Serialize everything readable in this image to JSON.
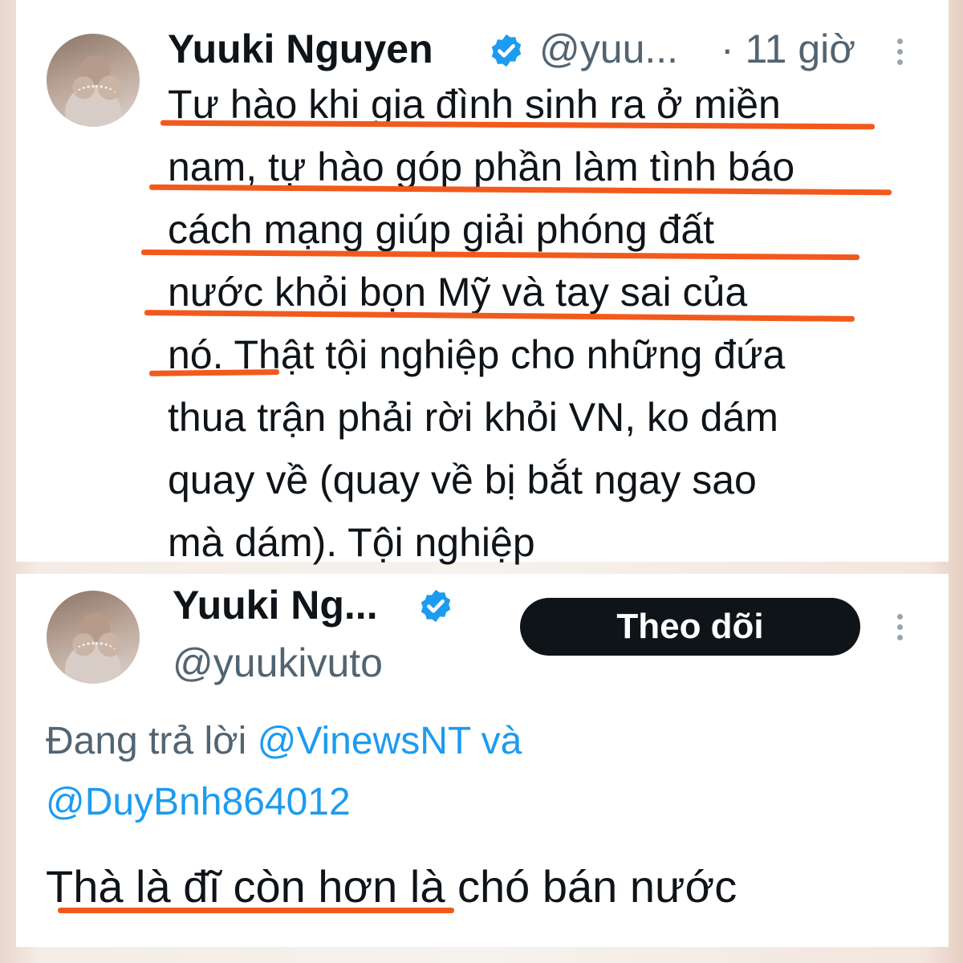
{
  "tweet1": {
    "name": "Yuuki Nguyen",
    "handle": "@yuu...",
    "time": "· 11 giờ",
    "lines": [
      "Tự hào khi gia đình sinh ra ở miền",
      "nam, tự hào góp phần làm tình báo",
      "cách mạng giúp giải phóng đất",
      "nước khỏi bọn Mỹ và tay sai của",
      "nó. Thật tội nghiệp cho những đứa",
      "thua trận phải rời khỏi VN, ko dám",
      "quay về (quay về bị bắt ngay sao",
      "mà dám). Tội nghiệp"
    ]
  },
  "tweet2": {
    "name": "Yuuki Ng...",
    "handle": "@yuukivuto",
    "follow_label": "Theo dõi",
    "replying_prefix": "Đang trả lời",
    "mention1": "@VinewsNT",
    "conjunction": "và",
    "mention2": "@DuyBnh864012",
    "text": "Thà là đĩ còn hơn là chó bán nước"
  },
  "colors": {
    "highlight_underline": "#f25a1d",
    "verified_badge": "#1d9bf0",
    "mention": "#1d9bf0",
    "secondary_text": "#536471"
  }
}
